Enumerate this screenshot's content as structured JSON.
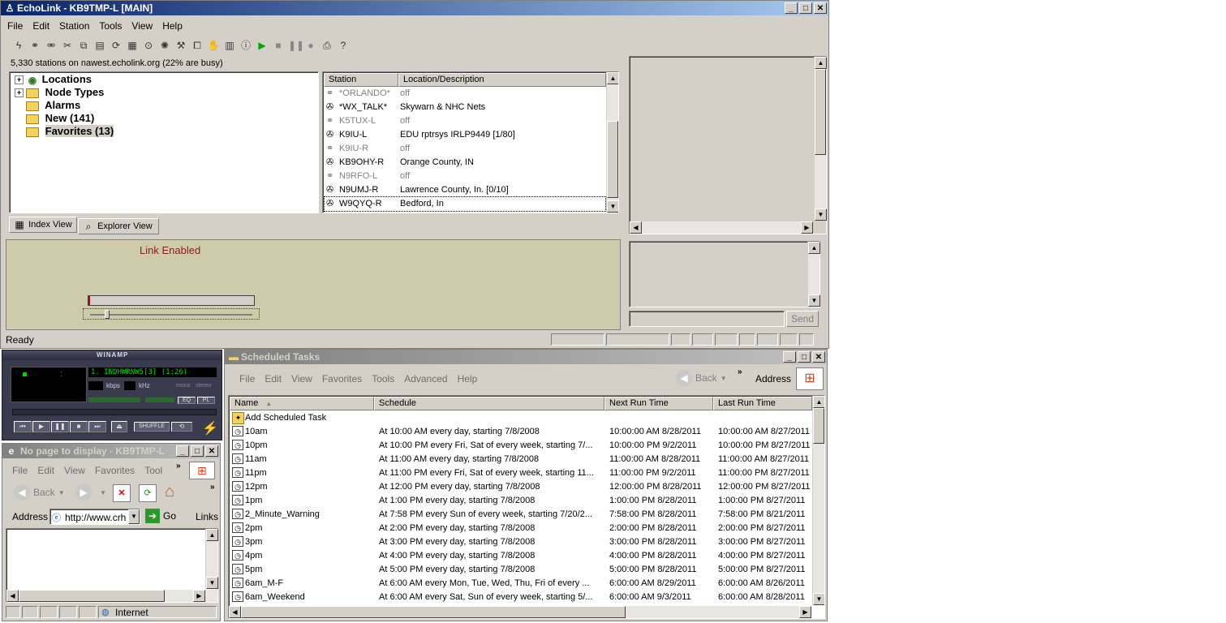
{
  "echolink": {
    "title": "EchoLink - KB9TMP-L [MAIN]",
    "menu": [
      "File",
      "Edit",
      "Station",
      "Tools",
      "View",
      "Help"
    ],
    "status_line": "5,330 stations on nawest.echolink.org (22% are busy)",
    "tree": [
      {
        "label": "Locations",
        "icon": "globe-icon"
      },
      {
        "label": "Node Types",
        "icon": "folder-icon"
      },
      {
        "label": "Alarms",
        "icon": "alarm-icon"
      },
      {
        "label": "New (141)",
        "icon": "folder-icon"
      },
      {
        "label": "Favorites (13)",
        "icon": "favorites-icon"
      }
    ],
    "station_headers": [
      "Station",
      "Location/Description"
    ],
    "stations": [
      {
        "call": "*ORLANDO*",
        "desc": "off",
        "busy": true
      },
      {
        "call": "*WX_TALK*",
        "desc": "Skywarn & NHC Nets",
        "busy": false
      },
      {
        "call": "K5TUX-L",
        "desc": "off",
        "busy": true
      },
      {
        "call": "K9IU-L",
        "desc": "EDU rptrsys IRLP9449 [1/80]",
        "busy": false
      },
      {
        "call": "K9IU-R",
        "desc": "off",
        "busy": true
      },
      {
        "call": "KB9OHY-R",
        "desc": "Orange County, IN",
        "busy": false
      },
      {
        "call": "N9RFO-L",
        "desc": "off",
        "busy": true
      },
      {
        "call": "N9UMJ-R",
        "desc": "Lawrence County, In. [0/10]",
        "busy": false
      },
      {
        "call": "W9QYQ-R",
        "desc": "Bedford, In",
        "busy": false
      }
    ],
    "tabs": [
      "Index View",
      "Explorer View"
    ],
    "link_text": "Link Enabled",
    "send_label": "Send",
    "ready": "Ready"
  },
  "winamp": {
    "title": "WINAMP",
    "track": "1. INDHWRNW5[3] (1:26)",
    "kbps": "kbps",
    "khz": "kHz",
    "mono": "mono",
    "stereo": "stereo",
    "eq": "EQ",
    "pl": "PL",
    "shuffle": "SHUFFLE"
  },
  "ie": {
    "title": "No page to display - KB9TMP-L",
    "menu": [
      "File",
      "Edit",
      "View",
      "Favorites",
      "Tool"
    ],
    "back": "Back",
    "address_label": "Address",
    "address_value": "http://www.crh",
    "go": "Go",
    "links": "Links",
    "zone": "Internet"
  },
  "tasks": {
    "title": "Scheduled Tasks",
    "menu": [
      "File",
      "Edit",
      "View",
      "Favorites",
      "Tools",
      "Advanced",
      "Help"
    ],
    "back": "Back",
    "address_label": "Address",
    "headers": [
      "Name",
      "Schedule",
      "Next Run Time",
      "Last Run Time"
    ],
    "add_task": "Add Scheduled Task",
    "rows": [
      {
        "name": "10am",
        "schedule": "At 10:00 AM every day, starting 7/8/2008",
        "next": "10:00:00 AM  8/28/2011",
        "last": "10:00:00 AM  8/27/2011"
      },
      {
        "name": "10pm",
        "schedule": "At 10:00 PM every Fri, Sat of every week, starting 7/...",
        "next": "10:00:00 PM  9/2/2011",
        "last": "10:00:00 PM  8/27/2011"
      },
      {
        "name": "11am",
        "schedule": "At 11:00 AM every day, starting 7/8/2008",
        "next": "11:00:00 AM  8/28/2011",
        "last": "11:00:00 AM  8/27/2011"
      },
      {
        "name": "11pm",
        "schedule": "At 11:00 PM every Fri, Sat of every week, starting 11...",
        "next": "11:00:00 PM  9/2/2011",
        "last": "11:00:00 PM  8/27/2011"
      },
      {
        "name": "12pm",
        "schedule": "At 12:00 PM every day, starting 7/8/2008",
        "next": "12:00:00 PM  8/28/2011",
        "last": "12:00:00 PM  8/27/2011"
      },
      {
        "name": "1pm",
        "schedule": "At 1:00 PM every day, starting 7/8/2008",
        "next": "1:00:00 PM  8/28/2011",
        "last": "1:00:00 PM  8/27/2011"
      },
      {
        "name": "2_Minute_Warning",
        "schedule": "At 7:58 PM every Sun of every week, starting 7/20/2...",
        "next": "7:58:00 PM  8/28/2011",
        "last": "7:58:00 PM  8/21/2011"
      },
      {
        "name": "2pm",
        "schedule": "At 2:00 PM every day, starting 7/8/2008",
        "next": "2:00:00 PM  8/28/2011",
        "last": "2:00:00 PM  8/27/2011"
      },
      {
        "name": "3pm",
        "schedule": "At 3:00 PM every day, starting 7/8/2008",
        "next": "3:00:00 PM  8/28/2011",
        "last": "3:00:00 PM  8/27/2011"
      },
      {
        "name": "4pm",
        "schedule": "At 4:00 PM every day, starting 7/8/2008",
        "next": "4:00:00 PM  8/28/2011",
        "last": "4:00:00 PM  8/27/2011"
      },
      {
        "name": "5pm",
        "schedule": "At 5:00 PM every day, starting 7/8/2008",
        "next": "5:00:00 PM  8/28/2011",
        "last": "5:00:00 PM  8/27/2011"
      },
      {
        "name": "6am_M-F",
        "schedule": "At 6:00 AM every Mon, Tue, Wed, Thu, Fri of every ...",
        "next": "6:00:00 AM  8/29/2011",
        "last": "6:00:00 AM  8/26/2011"
      },
      {
        "name": "6am_Weekend",
        "schedule": "At 6:00 AM every Sat, Sun of every week, starting 5/...",
        "next": "6:00:00 AM  9/3/2011",
        "last": "6:00:00 AM  8/28/2011"
      }
    ]
  }
}
